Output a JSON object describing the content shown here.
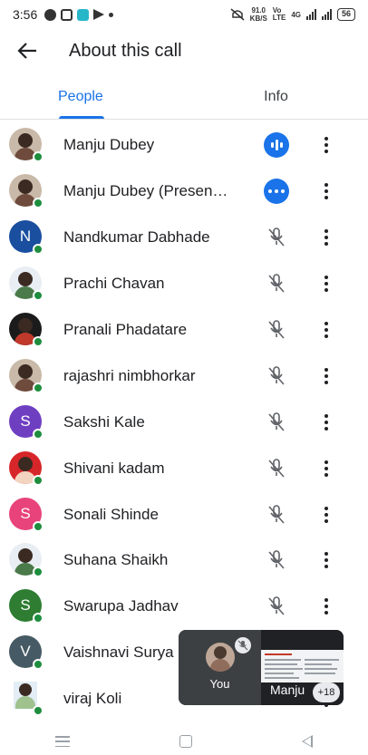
{
  "status_bar": {
    "time": "3:56",
    "net_speed_value": "91.0",
    "net_speed_unit": "KB/S",
    "network": "4G",
    "battery": "56"
  },
  "header": {
    "title": "About this call",
    "back_icon": "arrow-back-icon"
  },
  "tabs": [
    {
      "label": "People",
      "active": true
    },
    {
      "label": "Info",
      "active": false
    }
  ],
  "participants": [
    {
      "name": "Manju Dubey",
      "avatar": "photo",
      "status": "speaking"
    },
    {
      "name": "Manju Dubey (Presen…",
      "avatar": "photo",
      "status": "presenting"
    },
    {
      "name": "Nandkumar Dabhade",
      "avatar_letter": "N",
      "avatar_color": "#1a4fa0",
      "status": "muted"
    },
    {
      "name": "Prachi Chavan",
      "avatar": "photo",
      "status": "muted"
    },
    {
      "name": "Pranali Phadatare",
      "avatar": "photo",
      "status": "muted"
    },
    {
      "name": "rajashri nimbhorkar",
      "avatar": "photo",
      "status": "muted"
    },
    {
      "name": "Sakshi Kale",
      "avatar_letter": "S",
      "avatar_color": "#6f3fc2",
      "status": "muted"
    },
    {
      "name": "Shivani kadam",
      "avatar": "photo",
      "status": "muted"
    },
    {
      "name": "Sonali Shinde",
      "avatar_letter": "S",
      "avatar_color": "#e8437a",
      "status": "muted"
    },
    {
      "name": "Suhana Shaikh",
      "avatar": "photo",
      "status": "muted"
    },
    {
      "name": "Swarupa Jadhav",
      "avatar_letter": "S",
      "avatar_color": "#2e7d32",
      "status": "muted"
    },
    {
      "name": "Vaishnavi Surya",
      "avatar_letter": "V",
      "avatar_color": "#455a64",
      "status": ""
    },
    {
      "name": "viraj Koli",
      "avatar": "photo",
      "status": ""
    }
  ],
  "pip": {
    "self_label": "You",
    "other_name": "Manju",
    "extra_count": "+18"
  },
  "colors": {
    "accent": "#1a73e8",
    "online": "#1e8e3e"
  }
}
